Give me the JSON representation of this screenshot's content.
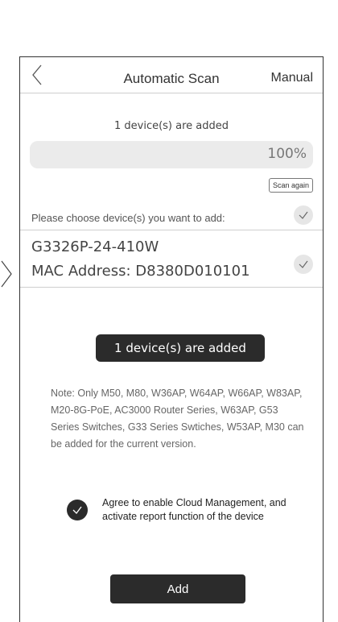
{
  "header": {
    "title": "Automatic Scan",
    "manual_label": "Manual"
  },
  "scan": {
    "summary": "1 device(s) are added",
    "progress_text": "100%",
    "progress_value": 100,
    "scan_again_label": "Scan again"
  },
  "choose": {
    "label": "Please choose device(s) you want to add:"
  },
  "device": {
    "model": "G3326P-24-410W",
    "mac": "MAC Address: D8380D010101"
  },
  "toast": {
    "text": "1 device(s) are added"
  },
  "note": {
    "text": "Note: Only M50, M80, W36AP, W64AP, W66AP, W83AP, M20-8G-PoE, AC3000 Router Series, W63AP, G53 Series Switches, G33 Series Swtiches, W53AP, M30 can be added for the current version."
  },
  "agree": {
    "text": "Agree to enable Cloud Management, and activate report function of the device"
  },
  "actions": {
    "add_label": "Add"
  }
}
